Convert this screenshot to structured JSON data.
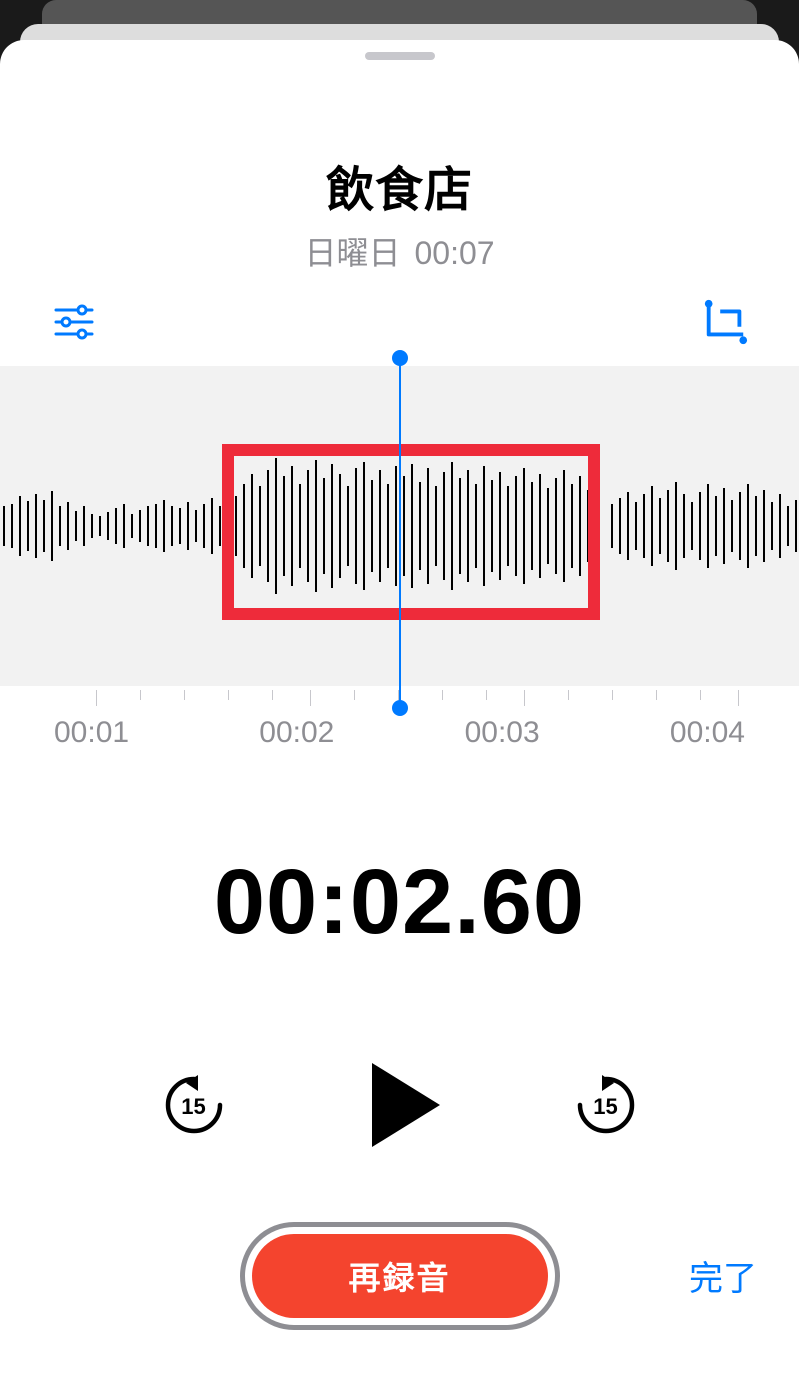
{
  "header": {
    "title": "飲食店",
    "day": "日曜日",
    "duration": "00:07"
  },
  "timeline": {
    "labels": [
      "00:01",
      "00:02",
      "00:03",
      "00:04"
    ]
  },
  "playback": {
    "current_time": "00:02.60",
    "skip_seconds": "15"
  },
  "actions": {
    "re_record": "再録音",
    "done": "完了"
  },
  "icons": {
    "settings": "settings-sliders",
    "crop": "crop"
  }
}
